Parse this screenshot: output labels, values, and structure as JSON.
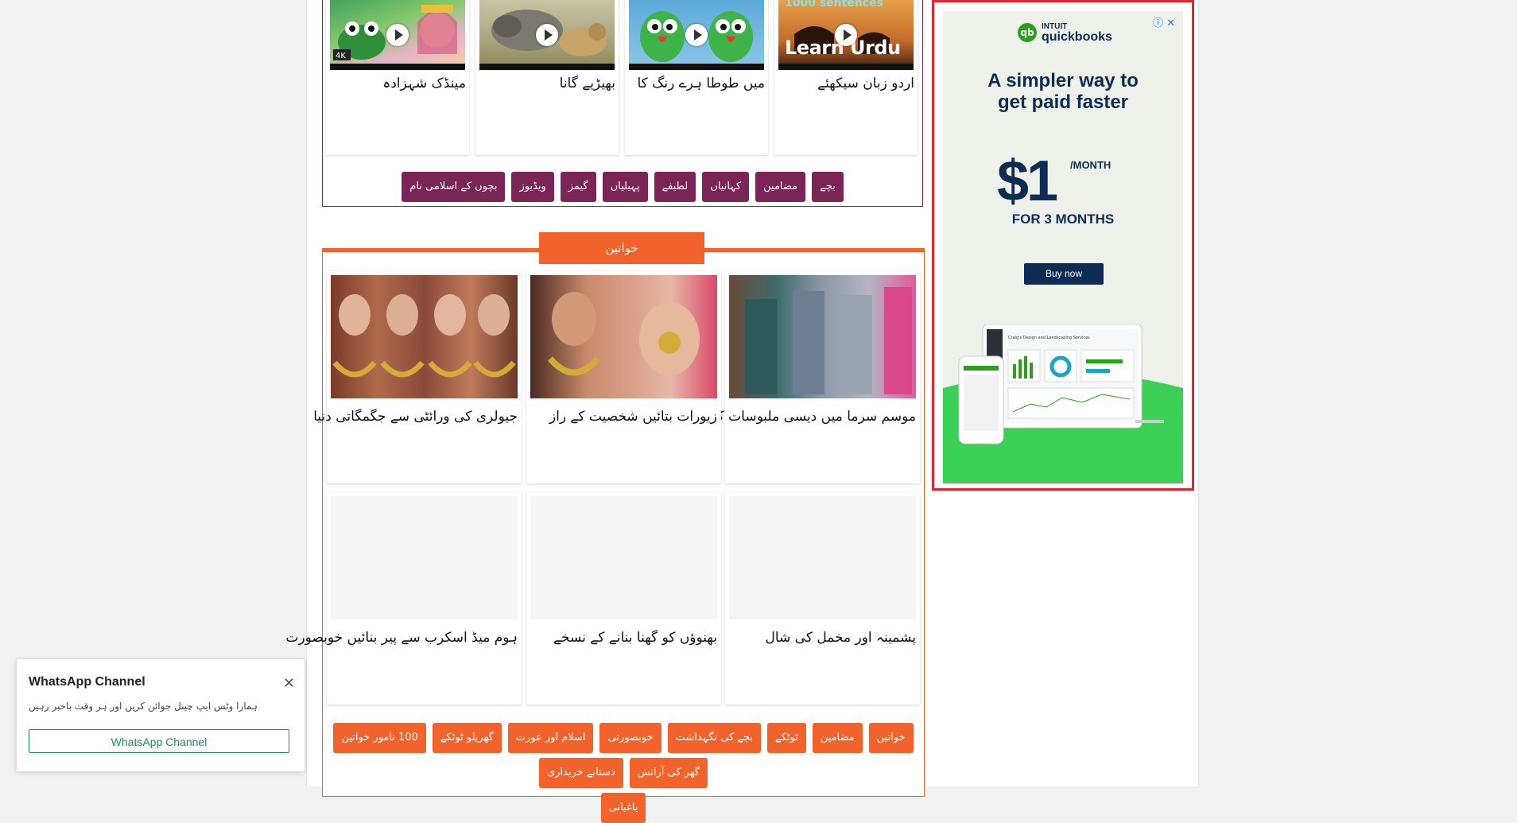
{
  "videos": [
    {
      "title": "مینڈک شہزادہ",
      "overlay": ""
    },
    {
      "title": "بھیڑیے گانا",
      "overlay": ""
    },
    {
      "title": "میں طوطا ہرے رنگ کا",
      "overlay": ""
    },
    {
      "title": "اردو زبان سیکھئے",
      "overlay": "1000 sentences",
      "overlay2": "Learn Urdu"
    }
  ],
  "kids_nav": [
    "بچے",
    "مضامین",
    "کہانیاں",
    "لطیفے",
    "پہیلیاں",
    "گیمز",
    "ویڈیوز",
    "بچوں کے اسلامی نام"
  ],
  "women_section": {
    "heading": "خواتین",
    "cards": [
      {
        "title": "موسم سرما میں دیسی ملبوسات کے ٹرینڈز"
      },
      {
        "title": "زیورات بتائیں شخصیت کے راز"
      },
      {
        "title": "جیولری کی ورائٹی سے جگمگاتی دنیا"
      },
      {
        "title": "پشمینہ اور مخمل کی شال"
      },
      {
        "title": "بھنوؤں کو گھنا بنانے کے نسخے"
      },
      {
        "title": "ہوم میڈ اسکرب سے پیر بنائیں خوبصورت"
      }
    ],
    "nav": [
      "خواتین",
      "مضامین",
      "ٹوٹکے",
      "بچے کی نگہداشت",
      "خوبصورتی",
      "اسلام اور عورت",
      "گھریلو ٹوٹکے",
      "100 نامور خواتین",
      "گھر کی آرائش",
      "دستانے خریداری",
      "باغبانی"
    ]
  },
  "ad": {
    "brand_top": "INTUIT",
    "brand": "quickbooks",
    "headline1": "A simpler way to",
    "headline2": "get paid faster",
    "price": "$1",
    "per": "/MONTH",
    "duration": "FOR 3 MONTHS",
    "cta": "Buy now",
    "app_title": "Craig's Design and Landscaping Services"
  },
  "whatsapp": {
    "title": "WhatsApp Channel",
    "text": "ہمارا وٹس ایپ چینل جوائن کریں اور ہر وقت باخبر رہیں",
    "button": "WhatsApp Channel"
  },
  "colors": {
    "kids_accent": "#7a2457",
    "women_accent": "#f2632c",
    "ad_border": "#e0262f",
    "qb_navy": "#0d2c54",
    "qb_green": "#2ca01c"
  }
}
